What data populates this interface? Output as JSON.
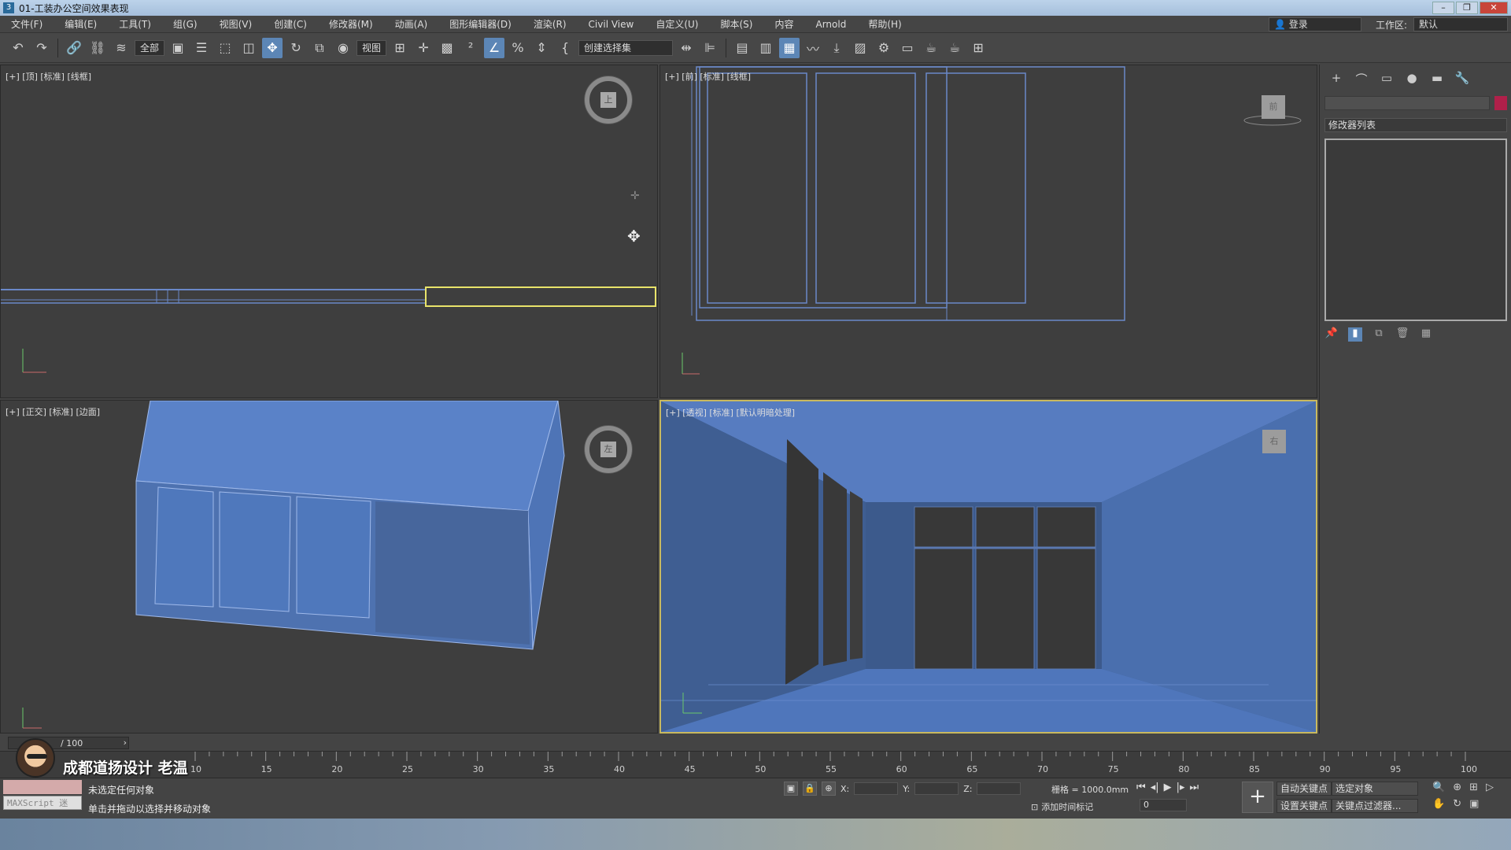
{
  "window": {
    "title": "01-工装办公空间效果表现",
    "app_icon": "3",
    "buttons": [
      "–",
      "❐",
      "✕"
    ]
  },
  "menu": {
    "items": [
      "文件(F)",
      "编辑(E)",
      "工具(T)",
      "组(G)",
      "视图(V)",
      "创建(C)",
      "修改器(M)",
      "动画(A)",
      "图形编辑器(D)",
      "渲染(R)",
      "Civil View",
      "自定义(U)",
      "脚本(S)",
      "内容",
      "Arnold",
      "帮助(H)"
    ],
    "login": "登录",
    "workspace_label": "工作区:",
    "workspace_value": "默认"
  },
  "toolbar": {
    "filter_value": "全部",
    "refcoord_value": "视图",
    "selset_value": "创建选择集",
    "icons": [
      "undo-icon",
      "redo-icon",
      "link-icon",
      "unlink-icon",
      "bind-spacewarp-icon",
      "select-object-icon",
      "select-by-name-icon",
      "rect-region-icon",
      "window-crossing-icon",
      "move-icon",
      "rotate-icon",
      "scale-icon",
      "placement-icon",
      "pivot-icon",
      "snap-icon",
      "angle-snap-icon",
      "percent-snap-icon",
      "spinner-snap-icon",
      "mirror-icon",
      "align-icon",
      "layer-icon",
      "scene-explorer-icon",
      "curve-editor-icon",
      "render-setup-icon",
      "render-icon"
    ]
  },
  "viewports": {
    "top": {
      "label": "[+] [顶] [标准] [线框]",
      "cube_face": "上"
    },
    "front": {
      "label": "[+] [前] [标准] [线框]",
      "cube_face": "前"
    },
    "left": {
      "label": "[+] [正交] [标准] [边面]",
      "cube_face": "左"
    },
    "persp": {
      "label": "[+] [透视] [标准] [默认明暗处理]",
      "cube_face": "右"
    }
  },
  "command_panel": {
    "tabs": [
      "+",
      "⌒",
      "▭",
      "●",
      "▬",
      "🔧"
    ],
    "modifier_list": "修改器列表",
    "colors": {
      "object_color": "#b0204a"
    }
  },
  "timeline": {
    "slider_label": "/ 100",
    "ticks": [
      10,
      15,
      20,
      25,
      30,
      35,
      40,
      45,
      50,
      55,
      60,
      65,
      70,
      75,
      80,
      85,
      90,
      95,
      100
    ]
  },
  "status": {
    "maxscript_label": "MAXScript 迷",
    "line1": "未选定任何对象",
    "line2": "单击并拖动以选择并移动对象",
    "x_label": "X:",
    "y_label": "Y:",
    "z_label": "Z:",
    "grid": "栅格 = 1000.0mm",
    "add_time_tag": "添加时间标记",
    "frame_value": "0",
    "auto_key": "自动关键点",
    "selected_object": "选定对象",
    "set_key": "设置关键点",
    "key_filter": "关键点过滤器..."
  },
  "brand": {
    "text": "成都道扬设计  老温"
  },
  "colors": {
    "viewport_bg": "#3e3e3e",
    "active_border": "#c9b95e",
    "model_blue": "#5a82c8",
    "accent": "#5c86b6"
  }
}
